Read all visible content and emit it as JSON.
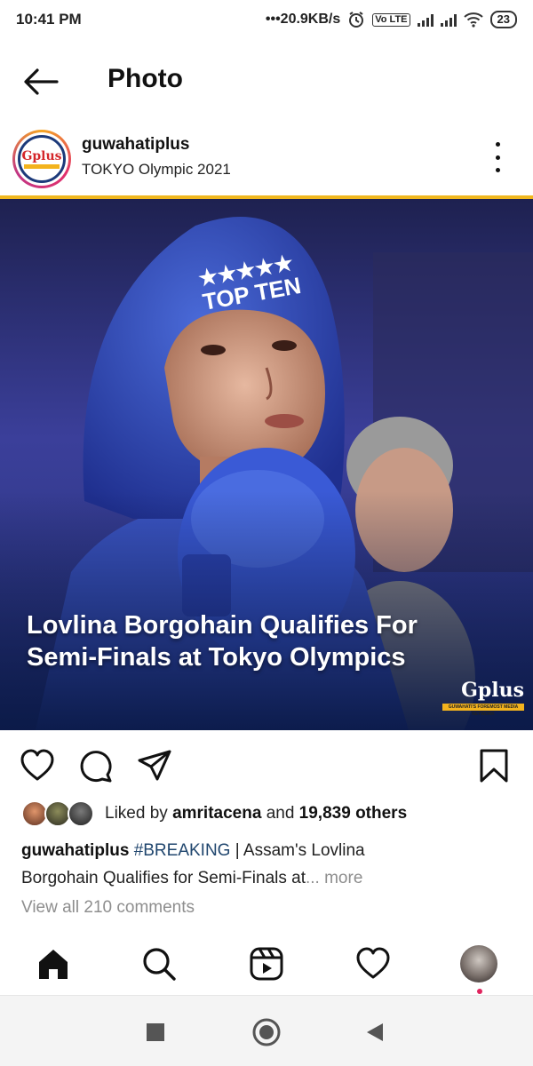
{
  "status_bar": {
    "time": "10:41 PM",
    "speed": "•••20.9KB/s",
    "volte": "Vo LTE",
    "battery": "23",
    "icons": [
      "alarm-icon",
      "volte-icon",
      "signal-icon",
      "signal-icon",
      "wifi-icon",
      "battery-icon"
    ]
  },
  "header": {
    "title": "Photo",
    "back_icon": "arrow-left-icon"
  },
  "post": {
    "username": "guwahatiplus",
    "location": "TOKYO Olympic 2021",
    "avatar_logo": "Gplus",
    "image_headline_line1": "Lovlina Borgohain Qualifies For",
    "image_headline_line2": "Semi-Finals at Tokyo Olympics",
    "image_logo": "Gplus",
    "image_logo_tagline": "GUWAHATI'S FOREMOST MEDIA NETWORK",
    "likes_prefix": "Liked by",
    "likes_user": "amritacena",
    "likes_and": "and",
    "likes_count": "19,839 others",
    "caption_user": "guwahatiplus",
    "caption_hashtag": "#BREAKING",
    "caption_text_1": " | Assam's Lovlina",
    "caption_text_2": "Borgohain Qualifies for Semi-Finals at",
    "caption_more": "... more",
    "view_comments": "View all 210 comments"
  },
  "colors": {
    "accent_gold": "#f0b71f",
    "hashtag": "#20466e",
    "muted": "#8e8e8e",
    "notification_dot": "#e0245e"
  },
  "bottom_nav": [
    "home-icon",
    "search-icon",
    "reels-icon",
    "heart-icon",
    "profile-avatar"
  ],
  "system_nav": [
    "recents-square-icon",
    "home-circle-icon",
    "back-triangle-icon"
  ]
}
